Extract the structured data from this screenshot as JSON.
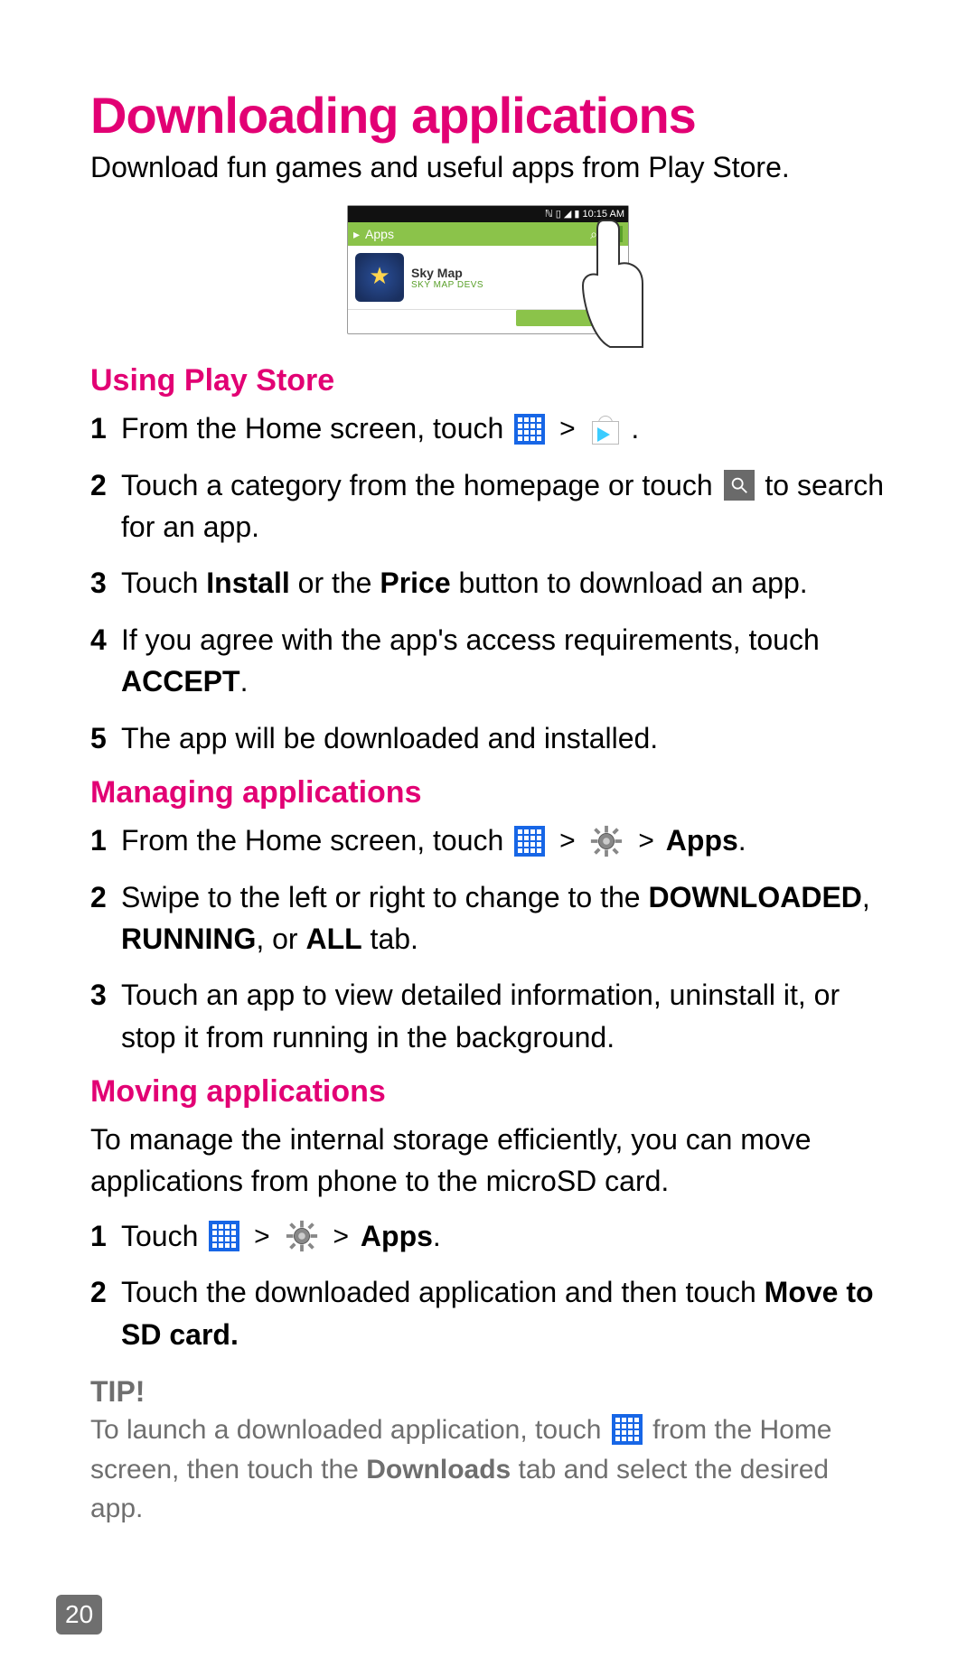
{
  "page_number": "20",
  "title": "Downloading applications",
  "intro": "Download fun games and useful apps from Play Store.",
  "screenshot": {
    "status_time": "10:15 AM",
    "apps_label": "Apps",
    "app_name": "Sky Map",
    "app_dev": "SKY MAP DEVS"
  },
  "sections": {
    "using": {
      "heading": "Using Play Store",
      "step1_a": "From the Home screen, touch ",
      "step1_b": ".",
      "step2_a": "Touch a category from the homepage or touch ",
      "step2_b": " to search for an app.",
      "step3_a": "Touch ",
      "step3_install": "Install",
      "step3_b": " or the ",
      "step3_price": "Price",
      "step3_c": " button to download an app.",
      "step4_a": "If you agree with the app's access requirements, touch ",
      "step4_accept": "ACCEPT",
      "step4_b": ".",
      "step5": "The app will be downloaded and installed."
    },
    "managing": {
      "heading": "Managing applications",
      "step1_a": "From the Home screen, touch ",
      "step1_apps": "Apps",
      "step1_b": ".",
      "step2_a": "Swipe to the left or right to change to the ",
      "step2_downloaded": "DOWNLOADED",
      "step2_b": ", ",
      "step2_running": "RUNNING",
      "step2_c": ", or ",
      "step2_all": "ALL",
      "step2_d": " tab.",
      "step3": "Touch an app to view detailed information, uninstall it, or stop it from running in the background."
    },
    "moving": {
      "heading": "Moving applications",
      "intro": "To manage the internal storage efficiently, you can move applications from phone to the microSD card.",
      "step1_a": "Touch ",
      "step1_apps": "Apps",
      "step1_b": ".",
      "step2_a": "Touch the downloaded application and then touch ",
      "step2_move": "Move to SD card."
    }
  },
  "tip": {
    "title": "TIP!",
    "a": "To launch a downloaded application, touch ",
    "b": " from the Home screen, then touch the ",
    "downloads": "Downloads",
    "c": " tab and select the desired app."
  },
  "glyphs": {
    "gt": ">",
    "status_icons": "ℕ ▯ ◢ ▮"
  }
}
